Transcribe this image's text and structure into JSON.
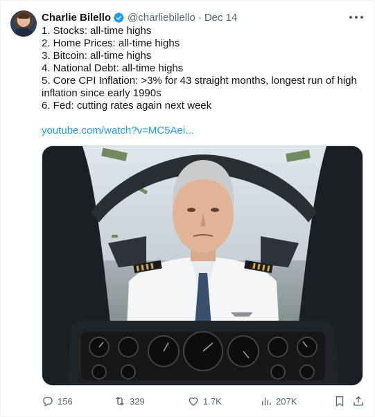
{
  "author": {
    "name": "Charlie Bilello",
    "handle": "@charliebilello",
    "separator": "·",
    "date": "Dec 14"
  },
  "tweet": {
    "lines": [
      "1. Stocks: all-time highs",
      "2. Home Prices: all-time highs",
      "3. Bitcoin: all-time highs",
      "4. National Debt: all-time highs",
      "5. Core CPI Inflation: >3% for 43 straight months, longest run of high inflation since early 1990s",
      "6. Fed: cutting rates again next week"
    ],
    "link": "youtube.com/watch?v=MC5Aei..."
  },
  "actions": {
    "replies": "156",
    "retweets": "329",
    "likes": "1.7K",
    "views": "207K"
  },
  "icons": {
    "verified": "verified-badge-icon",
    "more": "more-icon",
    "reply": "reply-icon",
    "retweet": "retweet-icon",
    "like": "heart-icon",
    "views": "views-icon",
    "bookmark": "bookmark-icon",
    "share": "share-icon"
  },
  "colors": {
    "accent": "#1d9bf0",
    "text": "#0f1419",
    "secondary": "#536471"
  }
}
